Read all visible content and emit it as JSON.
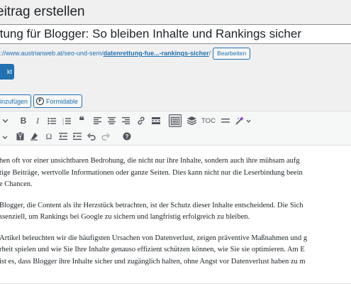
{
  "header": {
    "title": "eitrag erstellen"
  },
  "post": {
    "title": "ttung für Blogger: So bleiben Inhalte und Rankings sicher",
    "permalink_prefix": "s://www.austrianweb.at/seo-und-sem/",
    "permalink_slug": "datenrettung-fue...-rankings-sicher",
    "permalink_suffix": "/",
    "edit_label": "Bearbeiten"
  },
  "buttons": {
    "media_label": "kt",
    "insert_label": "inzufügen",
    "formidable_label": "Formidable"
  },
  "toolbar": {
    "bold": "B",
    "italic": "I",
    "quote": "❝",
    "toc_label": "TOC"
  },
  "content": {
    "lines": [
      "hen oft vor einer unsichtbaren Bedrohung, die nicht nur ihre Inhalte, sondern auch ihre mühsam aufg",
      "tige Beiträge, wertvolle Informationen oder ganze Seiten. Dies kann nicht nur die Leserbindung beein",
      "e Chancen.",
      "",
      "Blogger, die Content als ihr Herzstück betrachten, ist der Schutz dieser Inhalte entscheidend. Die Sich",
      "ssenziell, um Rankings bei Google zu sichern und langfristig erfolgreich zu bleiben.",
      "",
      "Artikel beleuchten wir die häufigsten Ursachen von Datenverlust, zeigen präventive Maßnahmen und g",
      "rheit spielen und wie Sie Ihre Inhalte genauso effizient schützen können, wie Sie sie optimieren. Am E",
      "ist es, dass Blogger ihre Inhalte sicher und zugänglich halten, ohne Angst vor Datenverlust haben zu m"
    ]
  },
  "colors": {
    "accent": "#2271b1",
    "background": "#f0f0f1",
    "toolbar_bg": "#f6f7f7",
    "text": "#1d2327",
    "icon": "#50575e"
  }
}
